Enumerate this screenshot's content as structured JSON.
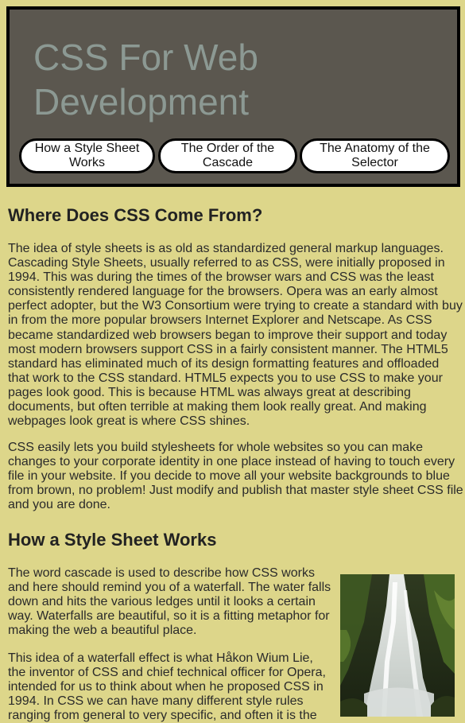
{
  "header": {
    "title_line1": "CSS For Web",
    "title_line2": "Development"
  },
  "nav": {
    "items": [
      {
        "line1": "How a Style Sheet",
        "line2": "Works"
      },
      {
        "line1": "The Order of the",
        "line2": "Cascade"
      },
      {
        "line1": "The Anatomy of the",
        "line2": "Selector"
      }
    ]
  },
  "sections": {
    "where": {
      "heading": "Where Does CSS Come From?",
      "p1_lines": [
        "The idea of style sheets is as old as standardized general markup languages.",
        "Cascading Style Sheets, usually referred to as CSS, were initially proposed in",
        "1994. This was during the times of the browser wars and CSS was the least",
        "consistently rendered language for the browsers. Opera was an early almost",
        "perfect adopter, but the W3 Consortium were trying to create a standard with buy",
        "in from the more popular browsers Internet Explorer and Netscape. As CSS",
        "became standardized web browsers began to improve their support and today",
        "most modern browsers support CSS in a fairly consistent manner. The HTML5",
        "standard has eliminated much of its design formatting features and offloaded",
        "that work to the CSS standard. HTML5 expects you to use CSS to make your",
        "pages look good. This is because HTML was always great at describing",
        "documents, but often terrible at making them look really great. And making",
        "webpages look great is where CSS shines."
      ],
      "p2_lines": [
        "CSS easily lets you build stylesheets for whole websites so you can make",
        "changes to your corporate identity in one place instead of having to touch every",
        "file in your website. If you decide to move all your website backgrounds to blue",
        "from brown, no problem! Just modify and publish that master style sheet CSS file",
        "and you are done."
      ]
    },
    "how": {
      "heading": "How a Style Sheet Works",
      "p1_lines": [
        "The word cascade is used to describe how CSS works",
        "and here should remind you of a waterfall. The water falls",
        "down and hits the various ledges until it looks a certain",
        "way. Waterfalls are beautiful, so it is a fitting metaphor for",
        "making the web a beautiful place."
      ],
      "p2_lines": [
        "This idea of a waterfall effect is what Håkon Wium Lie,",
        "the inventor of CSS and chief technical officer for Opera,",
        "intended for us to think about when he proposed CSS in",
        "1994. In CSS we can have many different style rules",
        "ranging from general to very specific, and often it is the"
      ]
    }
  },
  "colors": {
    "page_bg": "#ddd68a",
    "header_bg": "#5b574f",
    "title_color": "#8c9993"
  }
}
